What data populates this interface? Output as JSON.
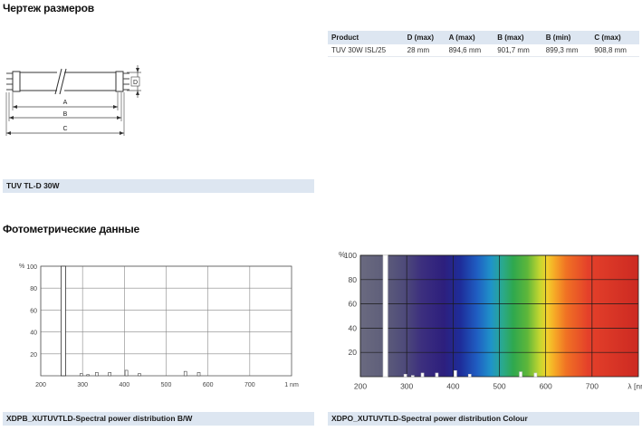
{
  "sections": {
    "dimensions_title": "Чертеж размеров",
    "photometric_title": "Фотометрические данные"
  },
  "dimension_table": {
    "headers": [
      "Product",
      "D (max)",
      "A (max)",
      "B (max)",
      "B (min)",
      "C (max)"
    ],
    "rows": [
      [
        "TUV 30W ISL/25",
        "28 mm",
        "894,6 mm",
        "901,7 mm",
        "899,3 mm",
        "908,8 mm"
      ]
    ]
  },
  "drawing": {
    "labels": {
      "A": "A",
      "B": "B",
      "C": "C",
      "D": "D"
    },
    "caption": "TUV TL-D 30W"
  },
  "chart_data": [
    {
      "type": "bar",
      "caption": "XDPB_XUTUVTLD-Spectral power distribution B/W",
      "y_unit": "%",
      "x_unit": "nm",
      "ylim": [
        0,
        100
      ],
      "xlim": [
        200,
        800
      ],
      "y_ticks": [
        "100",
        "80",
        "60",
        "40",
        "20"
      ],
      "x_ticks": [
        "200",
        "300",
        "400",
        "500",
        "600",
        "700"
      ],
      "x_last_label": "1 nm",
      "grid": true,
      "lines": [
        {
          "x": 254,
          "value": 100
        }
      ],
      "x": [
        297,
        313,
        334,
        365,
        405,
        436,
        546,
        578
      ],
      "values": [
        2,
        1,
        3,
        3,
        5,
        2,
        4,
        3
      ]
    },
    {
      "type": "bar",
      "caption": "XDPO_XUTUVTLD-Spectral power distribution Colour",
      "y_unit": "%",
      "x_unit": "λ [nm]",
      "ylim": [
        0,
        100
      ],
      "xlim": [
        200,
        800
      ],
      "y_ticks": [
        "100",
        "80",
        "60",
        "40",
        "20"
      ],
      "x_ticks": [
        "200",
        "300",
        "400",
        "500",
        "600",
        "700"
      ],
      "x_last_label": "λ [nm]",
      "grid": true,
      "lines": [
        {
          "x": 254,
          "value": 100
        }
      ],
      "x": [
        297,
        313,
        334,
        365,
        405,
        436,
        546,
        578
      ],
      "values": [
        2,
        1,
        3,
        3,
        5,
        2,
        4,
        3
      ]
    }
  ]
}
